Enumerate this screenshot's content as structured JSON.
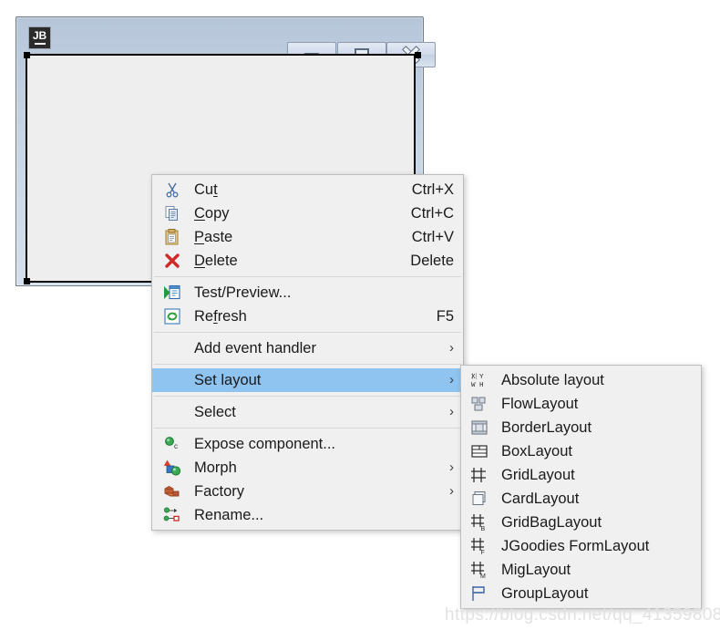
{
  "window": {
    "logo_text": "JB",
    "controls": [
      {
        "name": "minimize",
        "label": "Minimize"
      },
      {
        "name": "maximize",
        "label": "Maximize"
      },
      {
        "name": "close",
        "label": "Close"
      }
    ]
  },
  "context_menu": {
    "groups": [
      {
        "items": [
          {
            "icon": "cut-icon",
            "label_pre": "Cu",
            "mnemonic": "t",
            "label_post": "",
            "accel": "Ctrl+X",
            "arrow": false
          },
          {
            "icon": "copy-icon",
            "label_pre": "",
            "mnemonic": "C",
            "label_post": "opy",
            "accel": "Ctrl+C",
            "arrow": false
          },
          {
            "icon": "paste-icon",
            "label_pre": "",
            "mnemonic": "P",
            "label_post": "aste",
            "accel": "Ctrl+V",
            "arrow": false
          },
          {
            "icon": "delete-icon",
            "label_pre": "",
            "mnemonic": "D",
            "label_post": "elete",
            "accel": "Delete",
            "arrow": false
          }
        ]
      },
      {
        "items": [
          {
            "icon": "test-preview-icon",
            "label_pre": "Test/Preview...",
            "mnemonic": "",
            "label_post": "",
            "accel": "",
            "arrow": false
          },
          {
            "icon": "refresh-icon",
            "label_pre": "Re",
            "mnemonic": "f",
            "label_post": "resh",
            "accel": "F5",
            "arrow": false
          }
        ]
      },
      {
        "items": [
          {
            "icon": "",
            "label_pre": "Add event handler",
            "mnemonic": "",
            "label_post": "",
            "accel": "",
            "arrow": true
          }
        ]
      },
      {
        "items": [
          {
            "icon": "",
            "label_pre": "Set layout",
            "mnemonic": "",
            "label_post": "",
            "accel": "",
            "arrow": true,
            "selected": true
          }
        ]
      },
      {
        "items": [
          {
            "icon": "",
            "label_pre": "Select",
            "mnemonic": "",
            "label_post": "",
            "accel": "",
            "arrow": true
          }
        ]
      },
      {
        "items": [
          {
            "icon": "expose-component-icon",
            "label_pre": "Expose component...",
            "mnemonic": "",
            "label_post": "",
            "accel": "",
            "arrow": false
          },
          {
            "icon": "morph-icon",
            "label_pre": "Morph",
            "mnemonic": "",
            "label_post": "",
            "accel": "",
            "arrow": true
          },
          {
            "icon": "factory-icon",
            "label_pre": "Factory",
            "mnemonic": "",
            "label_post": "",
            "accel": "",
            "arrow": true
          },
          {
            "icon": "rename-icon",
            "label_pre": "Rename...",
            "mnemonic": "",
            "label_post": "",
            "accel": "",
            "arrow": false
          }
        ]
      }
    ]
  },
  "layout_submenu": {
    "items": [
      {
        "icon": "absolute-layout-icon",
        "label": "Absolute layout"
      },
      {
        "icon": "flow-layout-icon",
        "label": "FlowLayout"
      },
      {
        "icon": "border-layout-icon",
        "label": "BorderLayout"
      },
      {
        "icon": "box-layout-icon",
        "label": "BoxLayout"
      },
      {
        "icon": "grid-layout-icon",
        "label": "GridLayout"
      },
      {
        "icon": "card-layout-icon",
        "label": "CardLayout"
      },
      {
        "icon": "gridbag-layout-icon",
        "label": "GridBagLayout"
      },
      {
        "icon": "jgoodies-form-layout-icon",
        "label": "JGoodies FormLayout"
      },
      {
        "icon": "mig-layout-icon",
        "label": "MigLayout"
      },
      {
        "icon": "group-layout-icon",
        "label": "GroupLayout"
      }
    ]
  },
  "watermark": {
    "text": "https://blog.csdn.net/qq_41359808"
  },
  "colors": {
    "menu_background": "#f0f0f0",
    "selection_blue": "#8fc4f0",
    "titlebar_top": "#b6c6d9",
    "titlebar_bottom": "#d5e0ec",
    "canvas": "#eeeeee"
  }
}
